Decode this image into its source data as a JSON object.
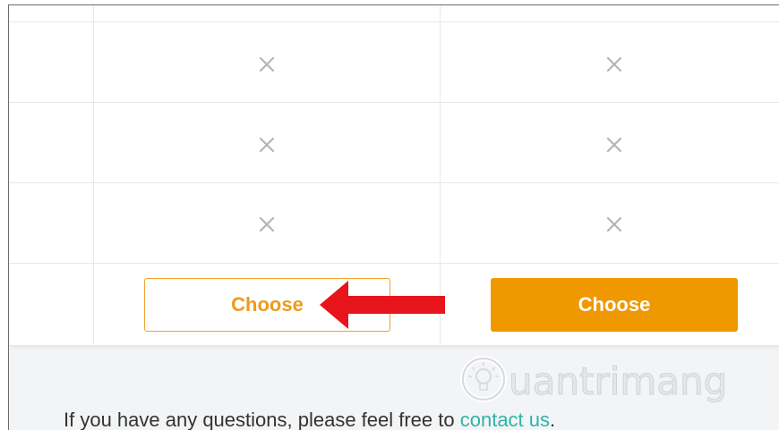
{
  "comparison_table": {
    "rows": [
      {
        "col1": "unavailable",
        "col2": "unavailable"
      },
      {
        "col1": "unavailable",
        "col2": "unavailable"
      },
      {
        "col1": "unavailable",
        "col2": "unavailable"
      }
    ],
    "icons": {
      "cell": "close-x-icon"
    }
  },
  "plans": {
    "plan_1": {
      "button_label": "Choose",
      "style": "outline"
    },
    "plan_2": {
      "button_label": "Choose",
      "style": "filled"
    }
  },
  "annotation": {
    "icon": "red-arrow-icon",
    "points_to": "plan_1 choose button"
  },
  "watermark": {
    "text": "uantrimang",
    "icon": "lightbulb-icon"
  },
  "footer": {
    "text_before": "If you have any questions, please feel free to ",
    "link_label": "contact us",
    "text_after": "."
  },
  "colors": {
    "accent_orange": "#ef9800",
    "link_teal": "#2fb4a7",
    "x_gray": "#b5b5b5",
    "arrow_red": "#e8141b"
  }
}
